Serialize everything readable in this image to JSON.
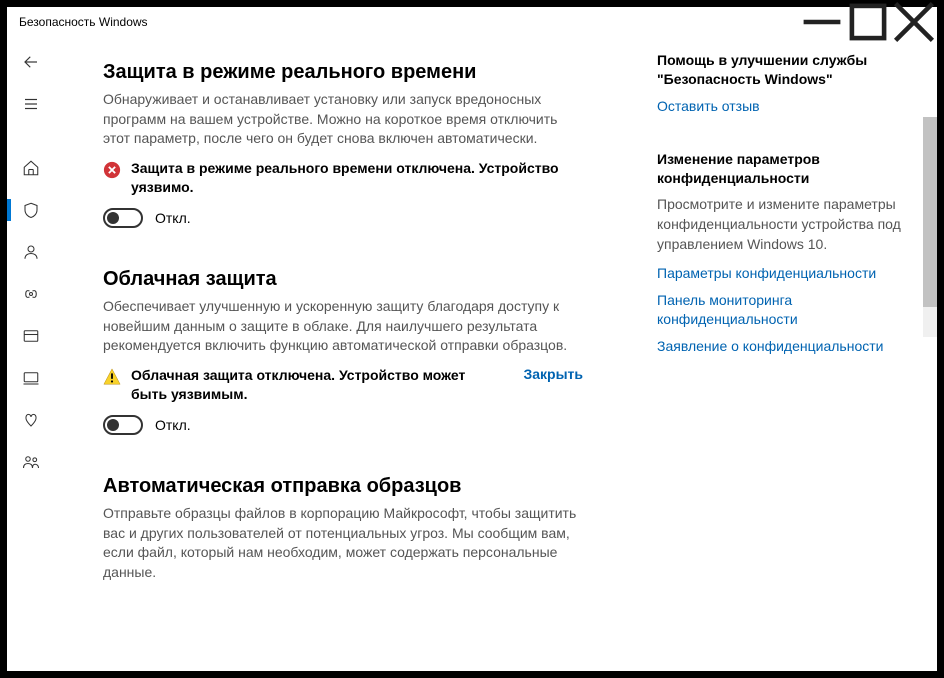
{
  "window": {
    "title": "Безопасность Windows"
  },
  "sections": {
    "realtime": {
      "title": "Защита в режиме реального времени",
      "desc": "Обнаруживает и останавливает установку или запуск вредоносных программ на вашем устройстве. Можно на короткое время отключить этот параметр, после чего он будет снова включен автоматически.",
      "alert": "Защита в режиме реального времени отключена. Устройство уязвимо.",
      "toggle_label": "Откл."
    },
    "cloud": {
      "title": "Облачная защита",
      "desc": "Обеспечивает улучшенную и ускоренную защиту благодаря доступу к новейшим данным о защите в облаке. Для наилучшего результата рекомендуется включить функцию автоматической отправки образцов.",
      "alert": "Облачная защита отключена. Устройство может быть уязвимым.",
      "dismiss": "Закрыть",
      "toggle_label": "Откл."
    },
    "samples": {
      "title": "Автоматическая отправка образцов",
      "desc": "Отправьте образцы файлов в корпорацию Майкрософт, чтобы защитить вас и других пользователей от потенциальных угроз. Мы сообщим вам, если файл, который нам необходим, может содержать персональные данные."
    }
  },
  "side": {
    "help": {
      "title": "Помощь в улучшении службы \"Безопасность Windows\"",
      "link": "Оставить отзыв"
    },
    "privacy": {
      "title": "Изменение параметров конфиденциальности",
      "desc": "Просмотрите и измените параметры конфиденциальности устройства под управлением Windows 10.",
      "link1": "Параметры конфиденциальности",
      "link2": "Панель мониторинга конфиденциальности",
      "link3": "Заявление о конфиденциальности"
    }
  }
}
